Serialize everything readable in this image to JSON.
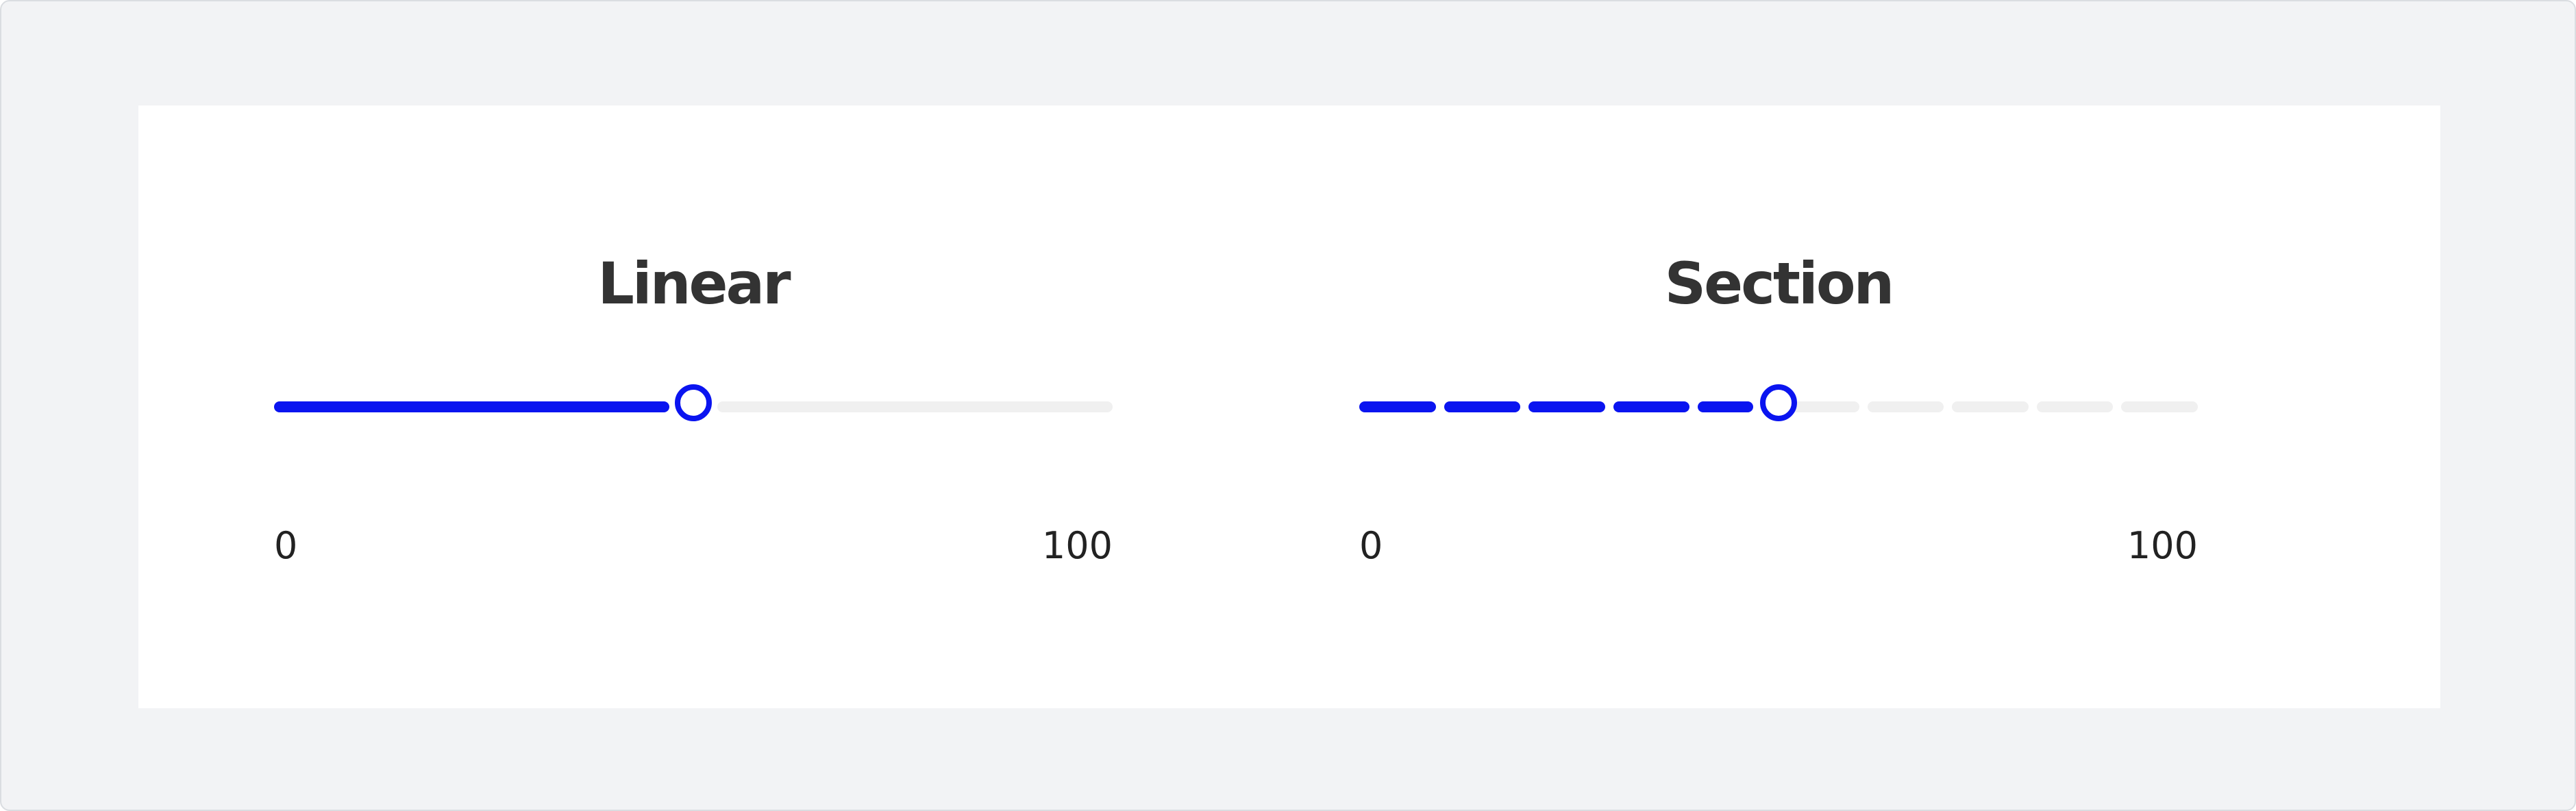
{
  "sliders": [
    {
      "title": "Linear",
      "type": "linear",
      "min_label": "0",
      "max_label": "100",
      "min": 0,
      "max": 100,
      "value": 50
    },
    {
      "title": "Section",
      "type": "section",
      "min_label": "0",
      "max_label": "100",
      "min": 0,
      "max": 100,
      "value": 50,
      "sections": 10
    }
  ],
  "colors": {
    "accent": "#0a14f0",
    "track_empty": "#f0f0f0",
    "background": "#f2f3f5",
    "card": "#ffffff",
    "title_text": "#333333"
  }
}
